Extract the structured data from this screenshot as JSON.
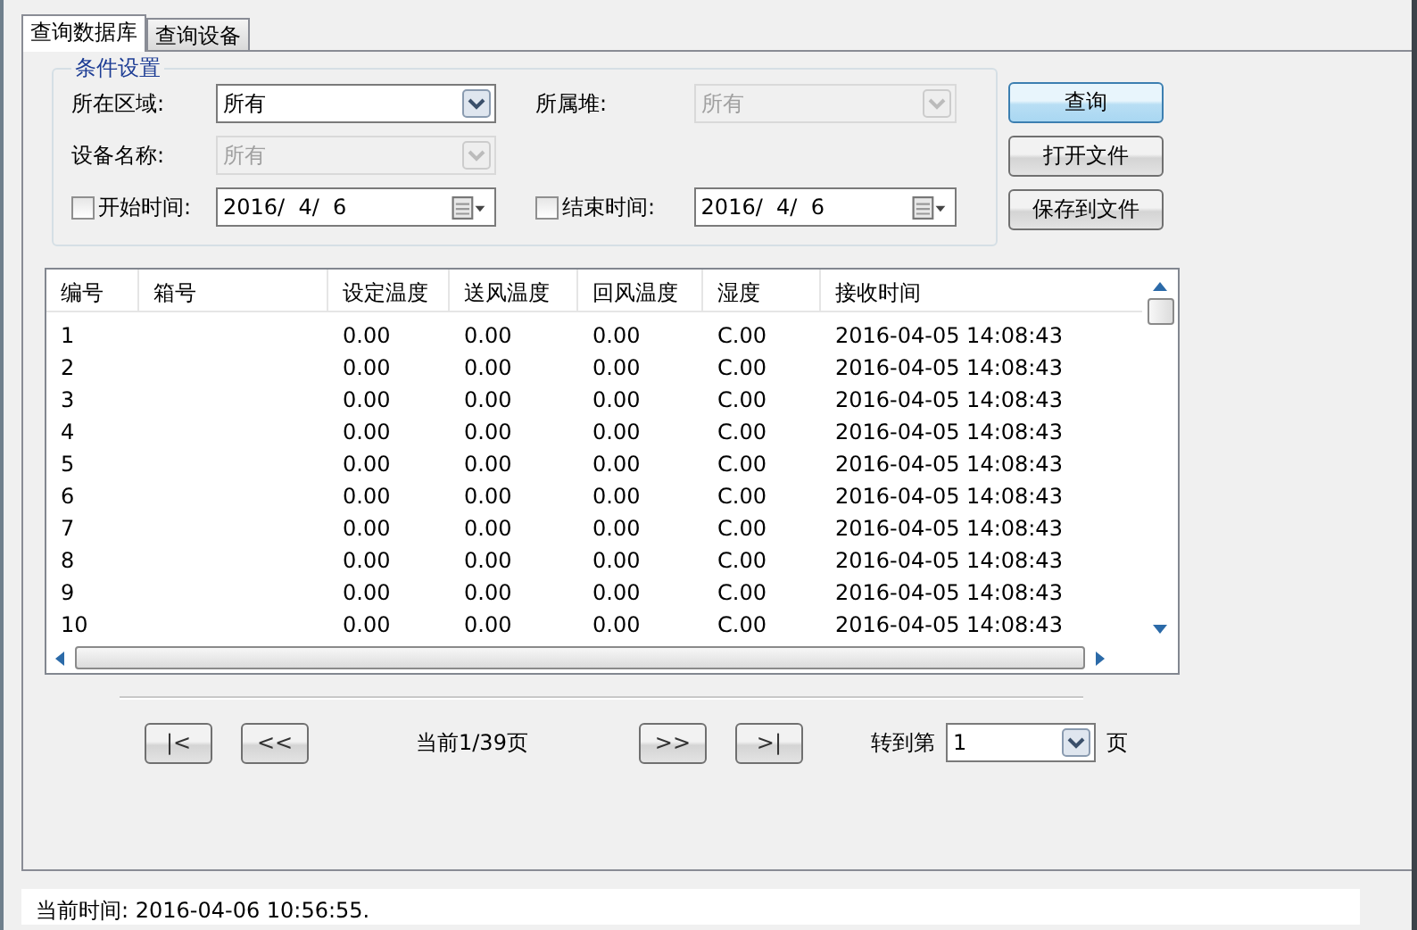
{
  "tabs": [
    {
      "label": "查询数据库",
      "selected": true
    },
    {
      "label": "查询设备",
      "selected": false
    }
  ],
  "filter": {
    "title": "条件设置",
    "fields": [
      {
        "kind": "combo",
        "label": "所在区域:",
        "value": "所有",
        "disabled": false
      },
      {
        "kind": "combo",
        "label": "所属堆:",
        "value": "所有",
        "disabled": true
      },
      {
        "kind": "combo",
        "label": "设备名称:",
        "value": "所有",
        "disabled": true
      },
      {
        "kind": "empty"
      },
      {
        "kind": "date",
        "label": "开始时间:",
        "value": "2016/  4/  6",
        "checked": false
      },
      {
        "kind": "date",
        "label": "结束时间:",
        "value": "2016/  4/  6",
        "checked": false
      }
    ]
  },
  "buttons": [
    {
      "label": "查询",
      "default": true
    },
    {
      "label": "打开文件",
      "default": false
    },
    {
      "label": "保存到文件",
      "default": false
    }
  ],
  "table": {
    "columns": [
      "编号",
      "箱号",
      "设定温度",
      "送风温度",
      "回风温度",
      "湿度",
      "接收时间"
    ],
    "rows": [
      [
        "1",
        "",
        "0.00",
        "0.00",
        "0.00",
        "C.00",
        "2016-04-05 14:08:43"
      ],
      [
        "2",
        "",
        "0.00",
        "0.00",
        "0.00",
        "C.00",
        "2016-04-05 14:08:43"
      ],
      [
        "3",
        "",
        "0.00",
        "0.00",
        "0.00",
        "C.00",
        "2016-04-05 14:08:43"
      ],
      [
        "4",
        "",
        "0.00",
        "0.00",
        "0.00",
        "C.00",
        "2016-04-05 14:08:43"
      ],
      [
        "5",
        "",
        "0.00",
        "0.00",
        "0.00",
        "C.00",
        "2016-04-05 14:08:43"
      ],
      [
        "6",
        "",
        "0.00",
        "0.00",
        "0.00",
        "C.00",
        "2016-04-05 14:08:43"
      ],
      [
        "7",
        "",
        "0.00",
        "0.00",
        "0.00",
        "C.00",
        "2016-04-05 14:08:43"
      ],
      [
        "8",
        "",
        "0.00",
        "0.00",
        "0.00",
        "C.00",
        "2016-04-05 14:08:43"
      ],
      [
        "9",
        "",
        "0.00",
        "0.00",
        "0.00",
        "C.00",
        "2016-04-05 14:08:43"
      ],
      [
        "10",
        "",
        "0.00",
        "0.00",
        "0.00",
        "C.00",
        "2016-04-05 14:08:43"
      ]
    ]
  },
  "pager": {
    "first": "|<",
    "prev": "<<",
    "page": "当前1/39页",
    "next": ">>",
    "last": ">|",
    "goto_label": "转到第",
    "goto_value": "1",
    "goto_suffix": "页"
  },
  "status_bar": "当前时间: 2016-04-06 10:56:55."
}
